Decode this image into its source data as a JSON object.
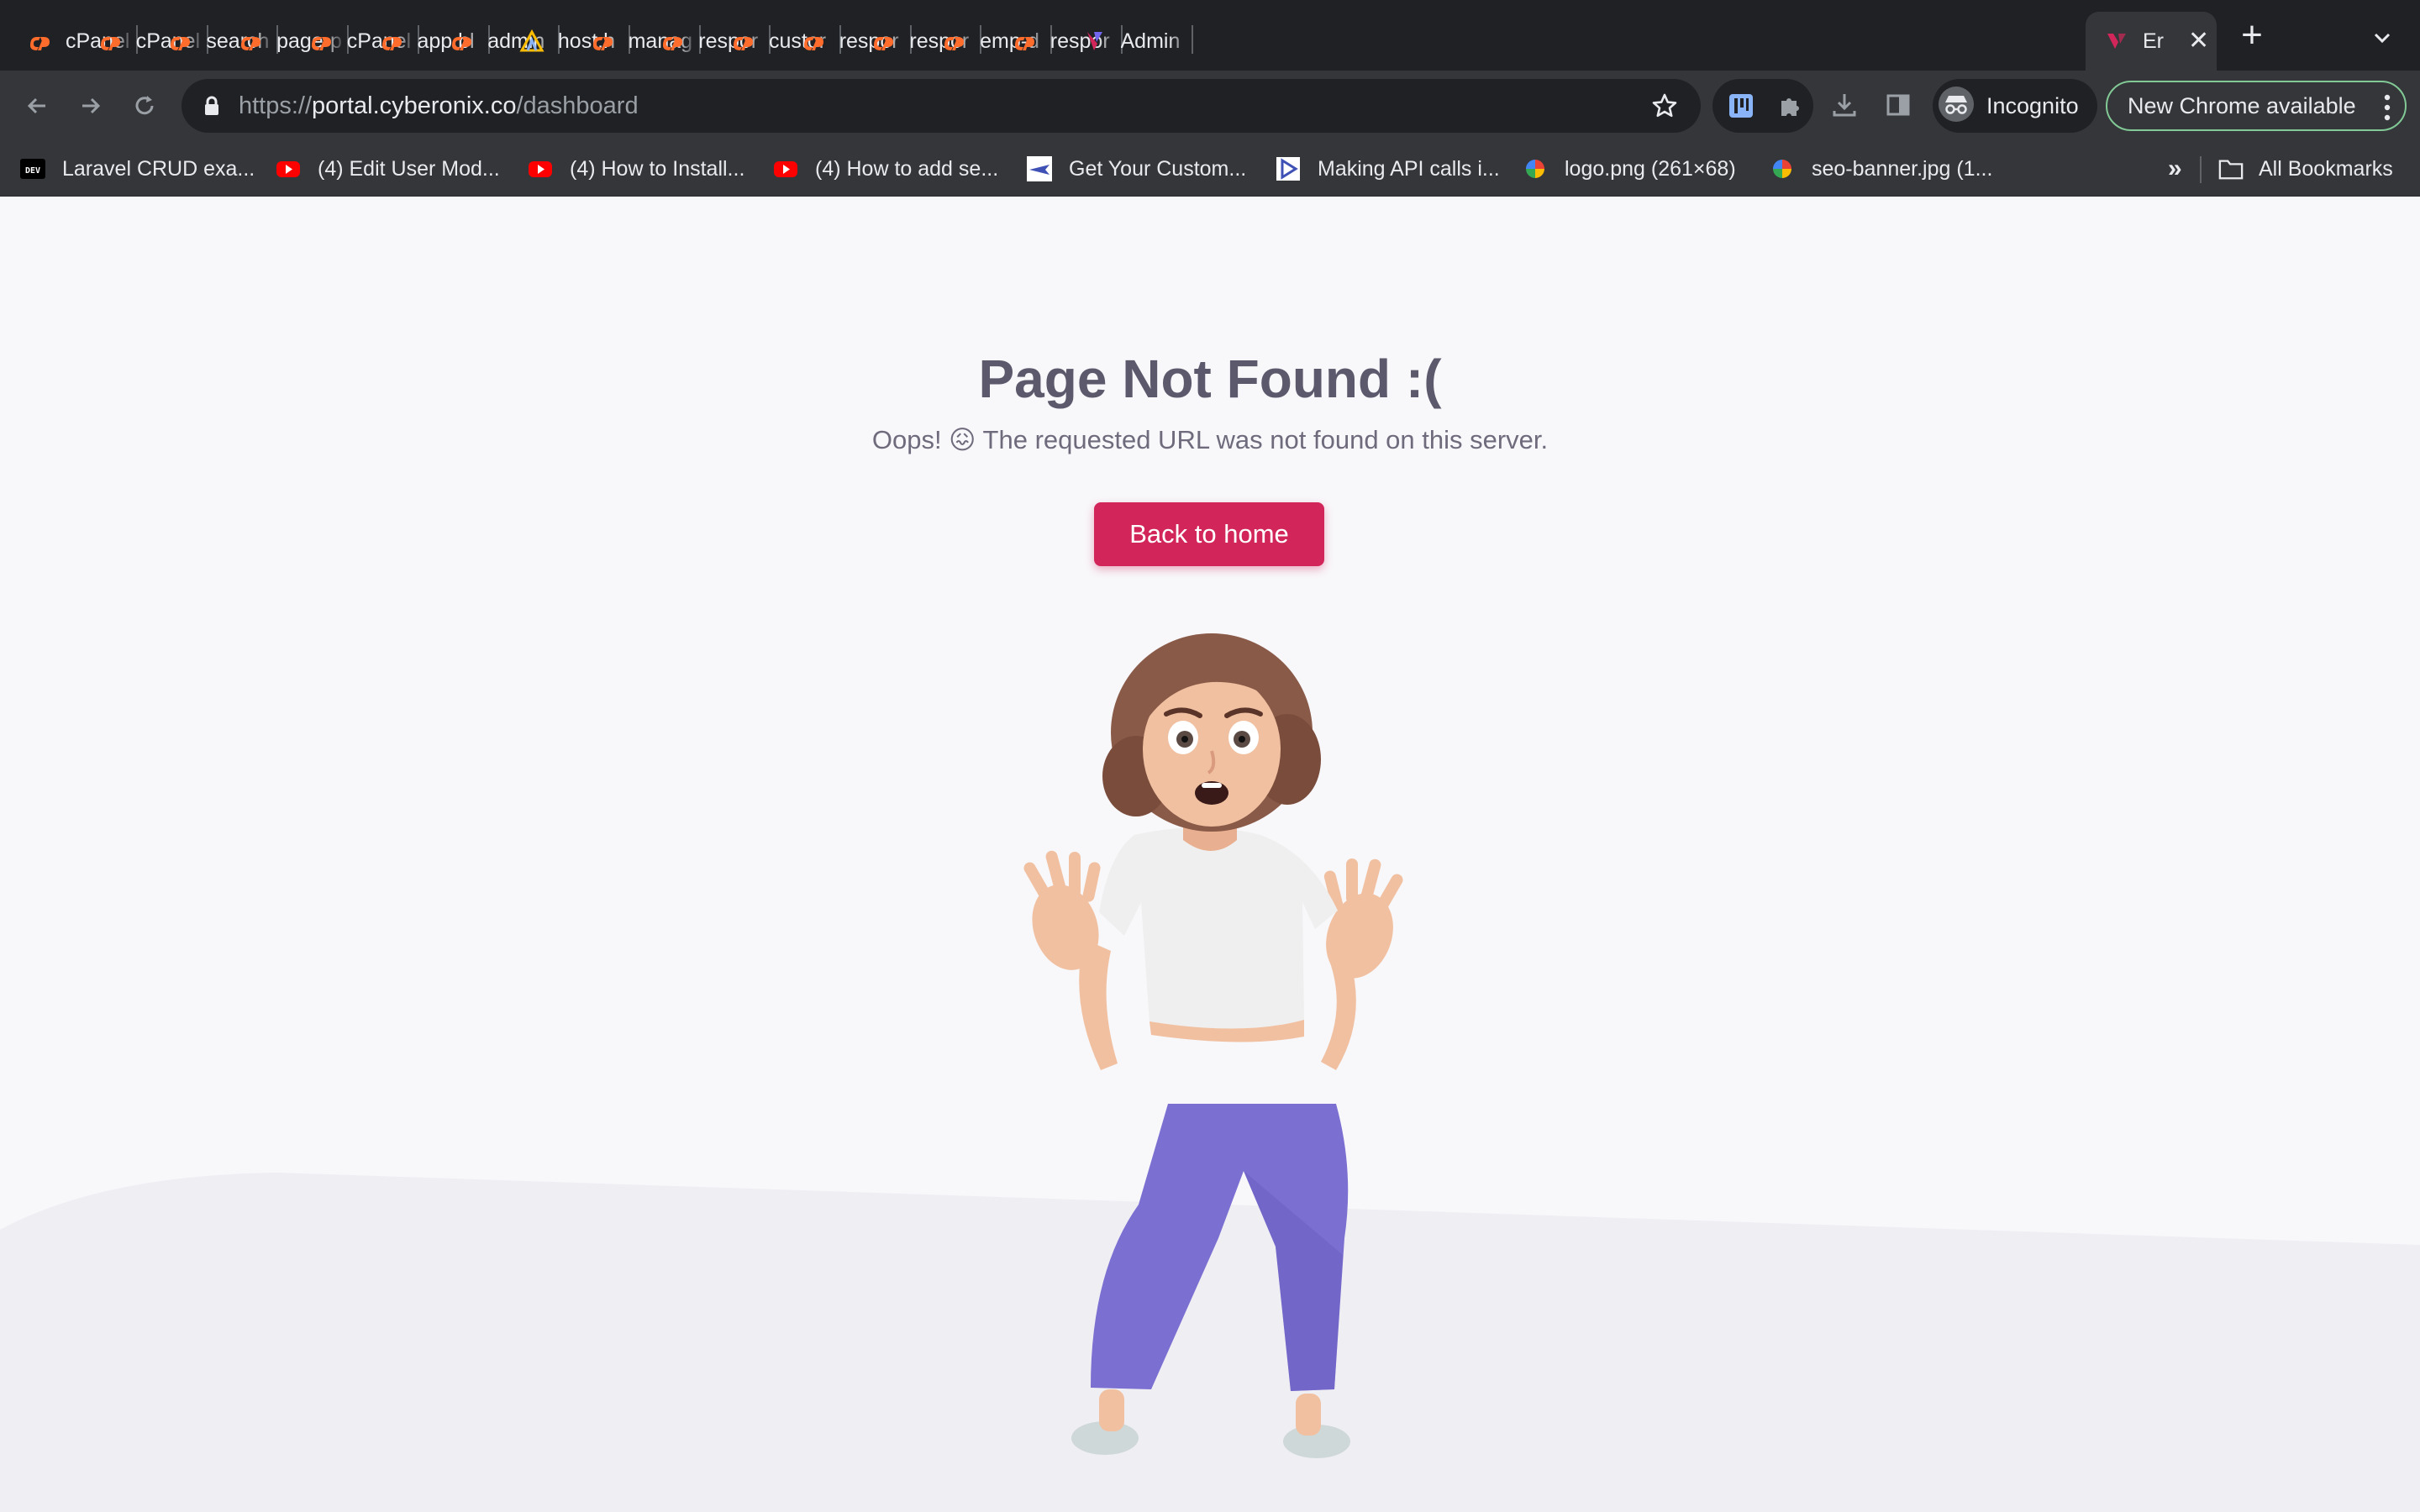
{
  "browser": {
    "tabs": [
      {
        "title": "cPanel",
        "favicon": "cpanel-icon"
      },
      {
        "title": "cPanel",
        "favicon": "cpanel-icon"
      },
      {
        "title": "search",
        "favicon": "cpanel-icon"
      },
      {
        "title": "page-p",
        "favicon": "cpanel-icon"
      },
      {
        "title": "cPanel",
        "favicon": "cpanel-icon"
      },
      {
        "title": "app.bl",
        "favicon": "cpanel-icon"
      },
      {
        "title": "admin",
        "favicon": "cpanel-icon"
      },
      {
        "title": "host.h",
        "favicon": "host-icon"
      },
      {
        "title": "manag",
        "favicon": "cpanel-icon"
      },
      {
        "title": "respor",
        "favicon": "cpanel-icon"
      },
      {
        "title": "custor",
        "favicon": "cpanel-icon"
      },
      {
        "title": "respor",
        "favicon": "cpanel-icon"
      },
      {
        "title": "respor",
        "favicon": "cpanel-icon"
      },
      {
        "title": "emp-d",
        "favicon": "cpanel-icon"
      },
      {
        "title": "respor",
        "favicon": "cpanel-icon"
      },
      {
        "title": "Admin",
        "favicon": "admin-icon"
      }
    ],
    "active_tab": {
      "title": "Er",
      "favicon": "vuexy-icon"
    },
    "url": {
      "scheme": "https://",
      "host": "portal.cyberonix.co",
      "path": "/dashboard"
    },
    "incognito_label": "Incognito",
    "update_label": "New Chrome available",
    "bookmarks": [
      {
        "label": "Laravel CRUD exa...",
        "favicon": "dev-icon"
      },
      {
        "label": "(4) Edit User Mod...",
        "favicon": "youtube-icon"
      },
      {
        "label": "(4) How to Install...",
        "favicon": "youtube-icon"
      },
      {
        "label": "(4) How to add se...",
        "favicon": "youtube-icon"
      },
      {
        "label": "Get Your Custom...",
        "favicon": "plane-icon"
      },
      {
        "label": "Making API calls i...",
        "favicon": "play-icon"
      },
      {
        "label": "logo.png (261×68)",
        "favicon": "image-icon"
      },
      {
        "label": "seo-banner.jpg (1...",
        "favicon": "image-icon"
      }
    ],
    "bookmarks_overflow": "»",
    "all_bookmarks_label": "All Bookmarks"
  },
  "page": {
    "title": "Page Not Found :(",
    "message": "Oops! 😖 The requested URL was not found on this server.",
    "home_button": "Back to home"
  },
  "colors": {
    "accent": "#d2265a",
    "heading": "#5d596c",
    "body_text": "#6f6b7d",
    "page_bg": "#f8f7fa",
    "cpanel_orange": "#ff6c2c",
    "pants": "#7b6fd1"
  }
}
